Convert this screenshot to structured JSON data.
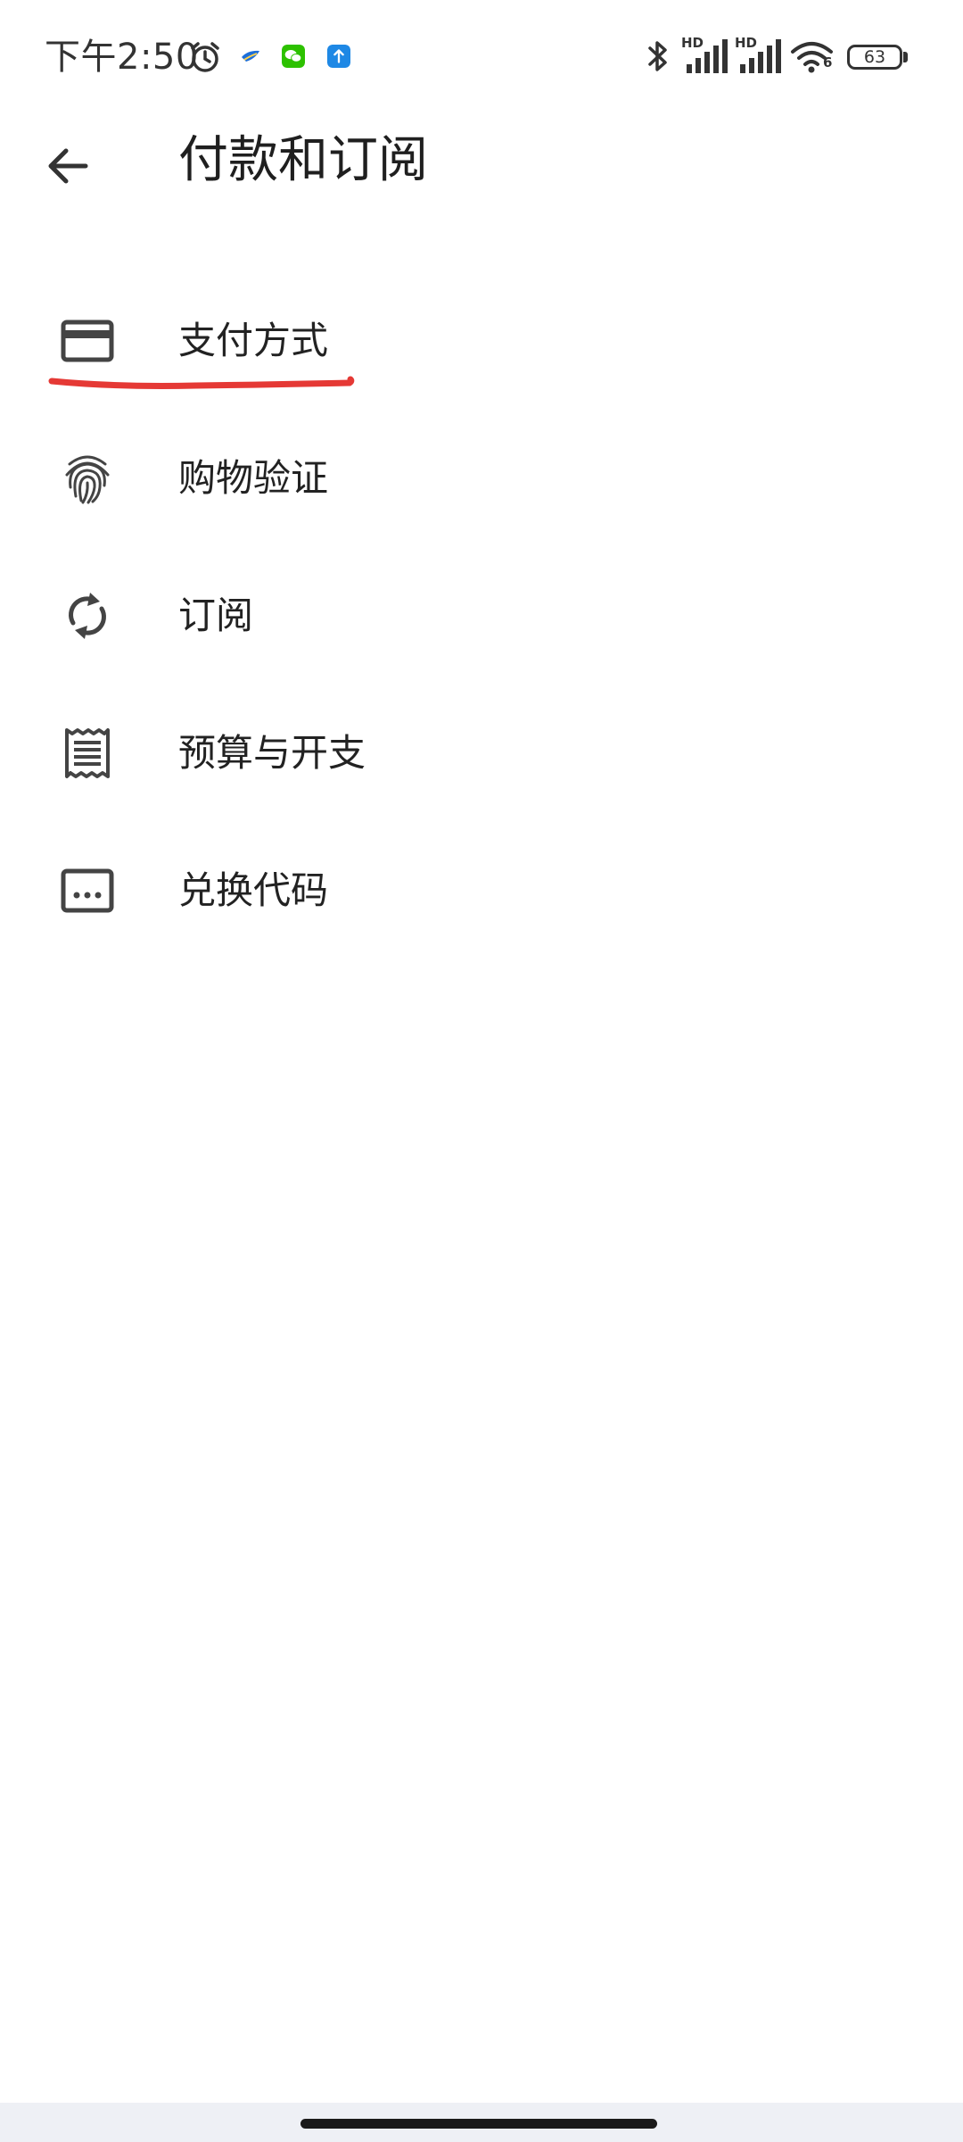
{
  "status_bar": {
    "time": "下午2:50",
    "battery": "63",
    "network_label_1": "HD",
    "network_label_2": "HD",
    "wifi_label": "6",
    "icons": [
      "alarm-icon",
      "feather-app-icon",
      "wechat-icon",
      "upload-app-icon",
      "bluetooth-icon",
      "signal-icon",
      "signal-icon",
      "wifi-icon",
      "battery-icon"
    ]
  },
  "toolbar": {
    "back_icon": "arrow-left-icon",
    "title": "付款和订阅"
  },
  "menu": {
    "items": [
      {
        "label": "支付方式",
        "icon": "credit-card-icon"
      },
      {
        "label": "购物验证",
        "icon": "fingerprint-icon"
      },
      {
        "label": "订阅",
        "icon": "sync-icon"
      },
      {
        "label": "预算与开支",
        "icon": "receipt-icon"
      },
      {
        "label": "兑换代码",
        "icon": "redeem-code-icon"
      }
    ]
  },
  "colors": {
    "annotation": "#e53935",
    "icon": "#444444",
    "nav_background": "#eef0f5"
  }
}
